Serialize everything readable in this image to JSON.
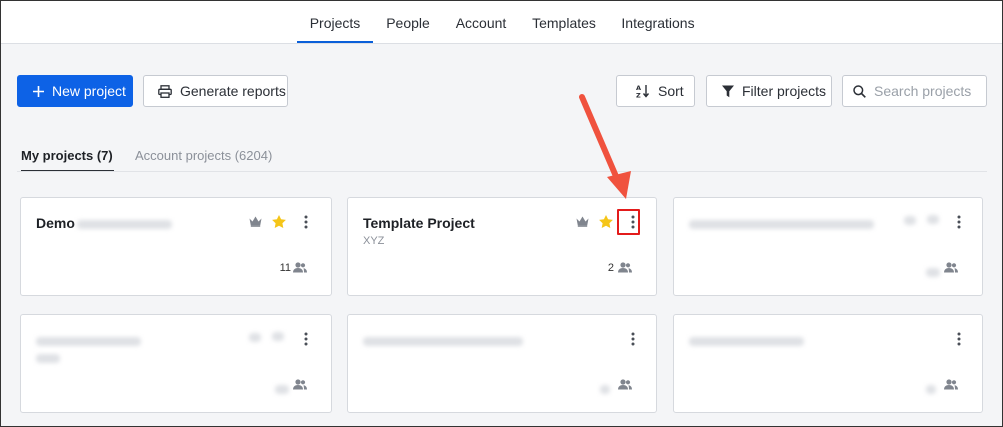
{
  "nav": {
    "tabs": [
      {
        "label": "Projects",
        "active": true
      },
      {
        "label": "People"
      },
      {
        "label": "Account"
      },
      {
        "label": "Templates"
      },
      {
        "label": "Integrations"
      }
    ]
  },
  "toolbar": {
    "new_project": "New project",
    "generate_reports": "Generate reports",
    "sort": "Sort",
    "filter": "Filter projects",
    "search_placeholder": "Search projects"
  },
  "subtabs": {
    "my_projects": "My projects (7)",
    "account_projects": "Account projects (6204)"
  },
  "cards": [
    {
      "title": "Demo",
      "subtitle": "",
      "count": "11",
      "favorite": true
    },
    {
      "title": "Template Project",
      "subtitle": "XYZ",
      "count": "2",
      "favorite": true
    }
  ],
  "colors": {
    "primary": "#0d62e6",
    "star": "#f5c518",
    "highlight": "#e31b1b",
    "arrow": "#f0523e"
  }
}
